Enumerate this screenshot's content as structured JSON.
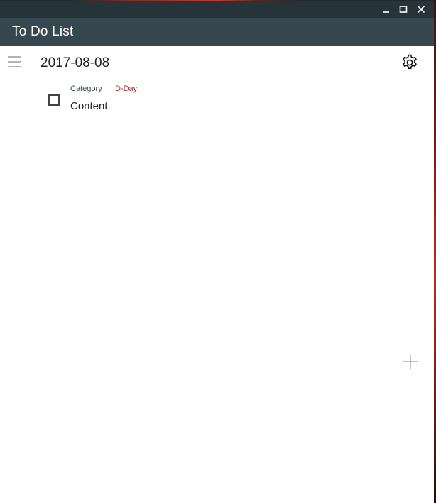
{
  "window": {
    "controls": {
      "minimize_icon": "minimize-icon",
      "maximize_icon": "maximize-icon",
      "close_icon": "close-icon"
    }
  },
  "appbar": {
    "title": "To Do List",
    "color": "#37474f"
  },
  "header": {
    "menu_icon": "hamburger-menu-icon",
    "date": "2017-08-08",
    "settings_icon": "gear-icon"
  },
  "todos": [
    {
      "category": "Category",
      "dday": "D-Day",
      "content": "Content",
      "checked": false
    }
  ],
  "actions": {
    "add_icon": "plus-icon"
  },
  "colors": {
    "titlebar": "#263339",
    "appbar": "#37474f",
    "dday": "#9e3030"
  }
}
